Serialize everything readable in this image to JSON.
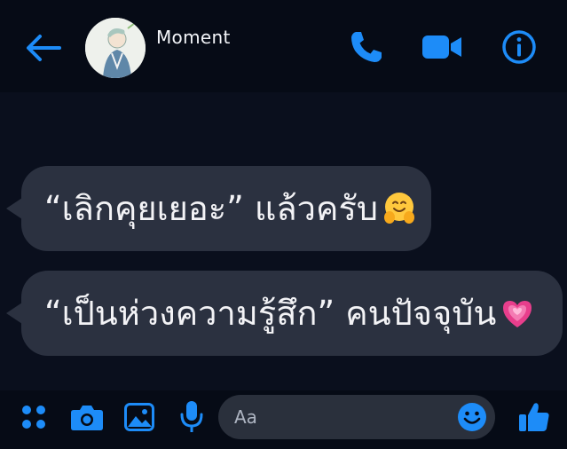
{
  "header": {
    "contact_name": "Moment"
  },
  "messages": [
    {
      "text": "“เลิกคุยเยอะ” แล้วครับ",
      "emoji": "hugging-face-emoji"
    },
    {
      "text": "“เป็นห่วงความรู้สึก” คนปัจจุบัน",
      "emoji": "growing-heart-emoji"
    }
  ],
  "composer": {
    "placeholder": "Aa"
  },
  "colors": {
    "accent": "#1d8cf8",
    "bubble": "#2b3140",
    "background": "#0a0f1d"
  }
}
